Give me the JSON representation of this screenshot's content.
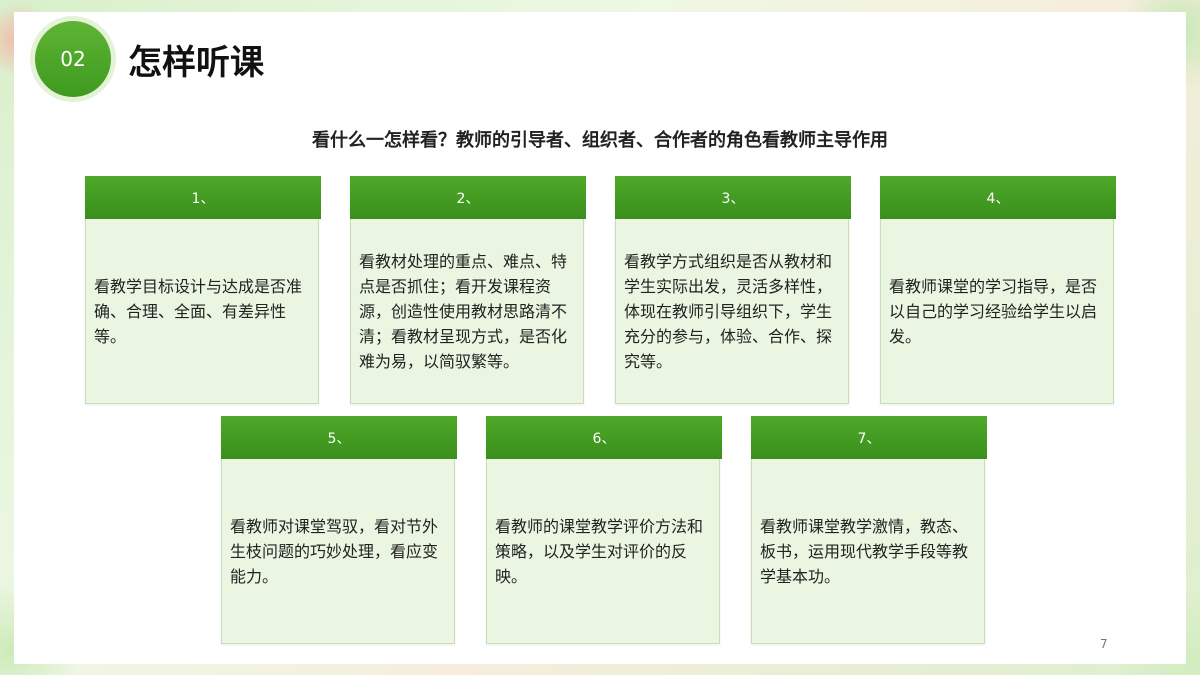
{
  "badge": {
    "number": "02"
  },
  "title": "怎样听课",
  "subtitle": "看什么一怎样看？教师的引导者、组织者、合作者的角色看教师主导作用",
  "cards": [
    {
      "label": "1、",
      "text": "看教学目标设计与达成是否准确、合理、全面、有差异性等。"
    },
    {
      "label": "2、",
      "text": "看教材处理的重点、难点、特点是否抓住；看开发课程资源，创造性使用教材思路清不清；看教材呈现方式，是否化难为易，以简驭繁等。"
    },
    {
      "label": "3、",
      "text": "看教学方式组织是否从教材和学生实际出发，灵活多样性，体现在教师引导组织下，学生充分的参与，体验、合作、探究等。"
    },
    {
      "label": "4、",
      "text": "看教师课堂的学习指导，是否以自己的学习经验给学生以启发。"
    },
    {
      "label": "5、",
      "text": "看教师对课堂驾驭，看对节外生枝问题的巧妙处理，看应变能力。"
    },
    {
      "label": "6、",
      "text": "看教师的课堂教学评价方法和策略，以及学生对评价的反映。"
    },
    {
      "label": "7、",
      "text": "看教师课堂教学激情，教态、板书，运用现代教学手段等教学基本功。"
    }
  ],
  "page_number": "7"
}
